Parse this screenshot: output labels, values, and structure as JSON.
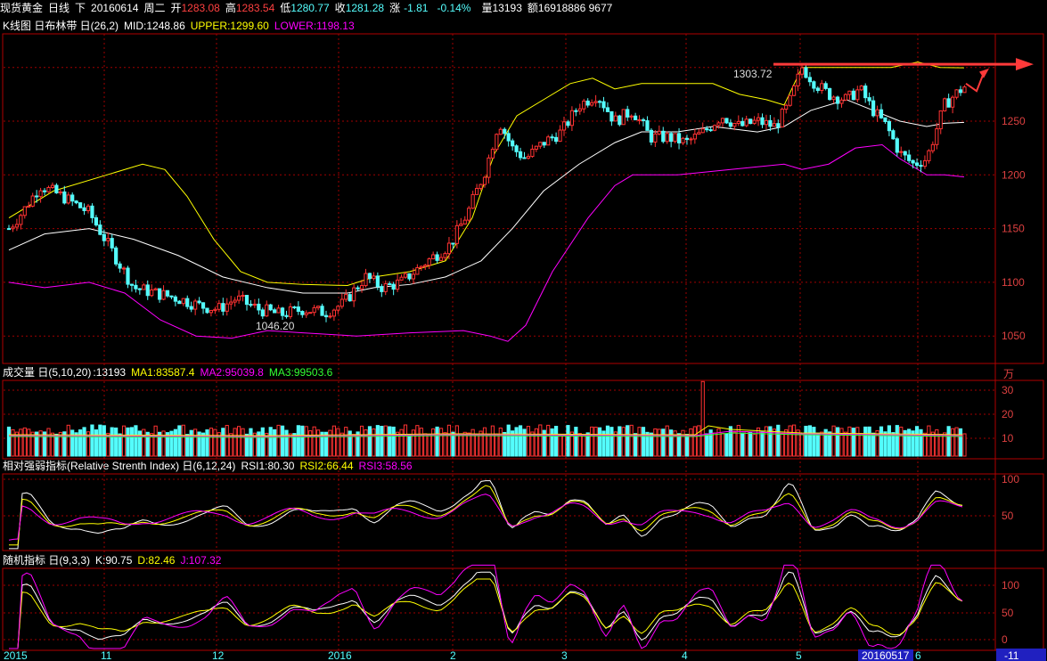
{
  "header": {
    "instrument": "现货黄金",
    "period": "日线",
    "direction": "下",
    "date": "20160614",
    "weekday": "周二",
    "open_label": "开",
    "open": "1283.08",
    "high_label": "高",
    "high": "1283.54",
    "low_label": "低",
    "low": "1280.77",
    "close_label": "收",
    "close": "1281.28",
    "change_label": "涨",
    "change": "-1.81",
    "change_pct": "-0.14%",
    "volume_label": "量",
    "volume": "13193",
    "amount_label": "额",
    "amount": "16918886 9677"
  },
  "kline_panel": {
    "label": "K线图 日布林带 日(26,2)",
    "mid_text": "MID:1248.86",
    "upper_text": "UPPER:1299.60",
    "lower_text": "LOWER:1198.13",
    "y_ticks": [
      "1250",
      "1200",
      "1150",
      "1100",
      "1050"
    ],
    "annot_high": "1303.72",
    "annot_low": "1046.20"
  },
  "volume_panel": {
    "label": "成交量 日(5,10,20)",
    "value_text": ":13193",
    "ma1_text": "MA1:83587.4",
    "ma2_text": "MA2:95039.8",
    "ma3_text": "MA3:99503.6",
    "unit": "万",
    "y_ticks": [
      "30",
      "20",
      "10"
    ]
  },
  "rsi_panel": {
    "label": "相对强弱指标(Relative Strenth Index) 日(6,12,24)",
    "rsi1_text": "RSI1:80.30",
    "rsi2_text": "RSI2:66.44",
    "rsi3_text": "RSI3:58.56",
    "y_ticks": [
      "100",
      "50"
    ]
  },
  "kdj_panel": {
    "label": "随机指标 日(9,3,3)",
    "k_text": "K:90.75",
    "d_text": "D:82.46",
    "j_text": "J:107.32",
    "y_ticks": [
      "100",
      "50",
      "0"
    ]
  },
  "x_axis": {
    "labels": [
      "2015",
      "11",
      "12",
      "2016",
      "2",
      "3",
      "4",
      "5",
      "20160517",
      "6"
    ],
    "corner": "-11"
  },
  "colors": {
    "up": "#ff3232",
    "down": "#54fcfc",
    "grid": "#a00000",
    "upper": "#ffff00",
    "mid": "#ffffff",
    "lower": "#ff00ff"
  },
  "chart_data": {
    "type": "candlestick",
    "title": "现货黄金 日线",
    "ylim": [
      1030,
      1330
    ],
    "close_series_sampled": [
      {
        "period": "2015-10",
        "close": 1150
      },
      {
        "period": "2015-11",
        "close": 1090
      },
      {
        "period": "2015-12",
        "close": 1065
      },
      {
        "period": "2016-01",
        "close": 1090
      },
      {
        "period": "2016-02",
        "close": 1225
      },
      {
        "period": "2016-03",
        "close": 1245
      },
      {
        "period": "2016-04",
        "close": 1255
      },
      {
        "period": "2016-05",
        "close": 1285
      },
      {
        "period": "2016-05-17",
        "close": 1275
      },
      {
        "period": "2016-06",
        "close": 1283
      }
    ],
    "last_bar": {
      "open": 1283.08,
      "high": 1283.54,
      "low": 1280.77,
      "close": 1281.28
    },
    "bollinger": {
      "mid": 1248.86,
      "upper": 1299.6,
      "lower": 1198.13
    },
    "volume": {
      "last": 13193,
      "ma1": 83587.4,
      "ma2": 95039.8,
      "ma3": 99503.6
    },
    "rsi": {
      "rsi1": 80.3,
      "rsi2": 66.44,
      "rsi3": 58.56
    },
    "kdj": {
      "k": 90.75,
      "d": 82.46,
      "j": 107.32
    }
  }
}
